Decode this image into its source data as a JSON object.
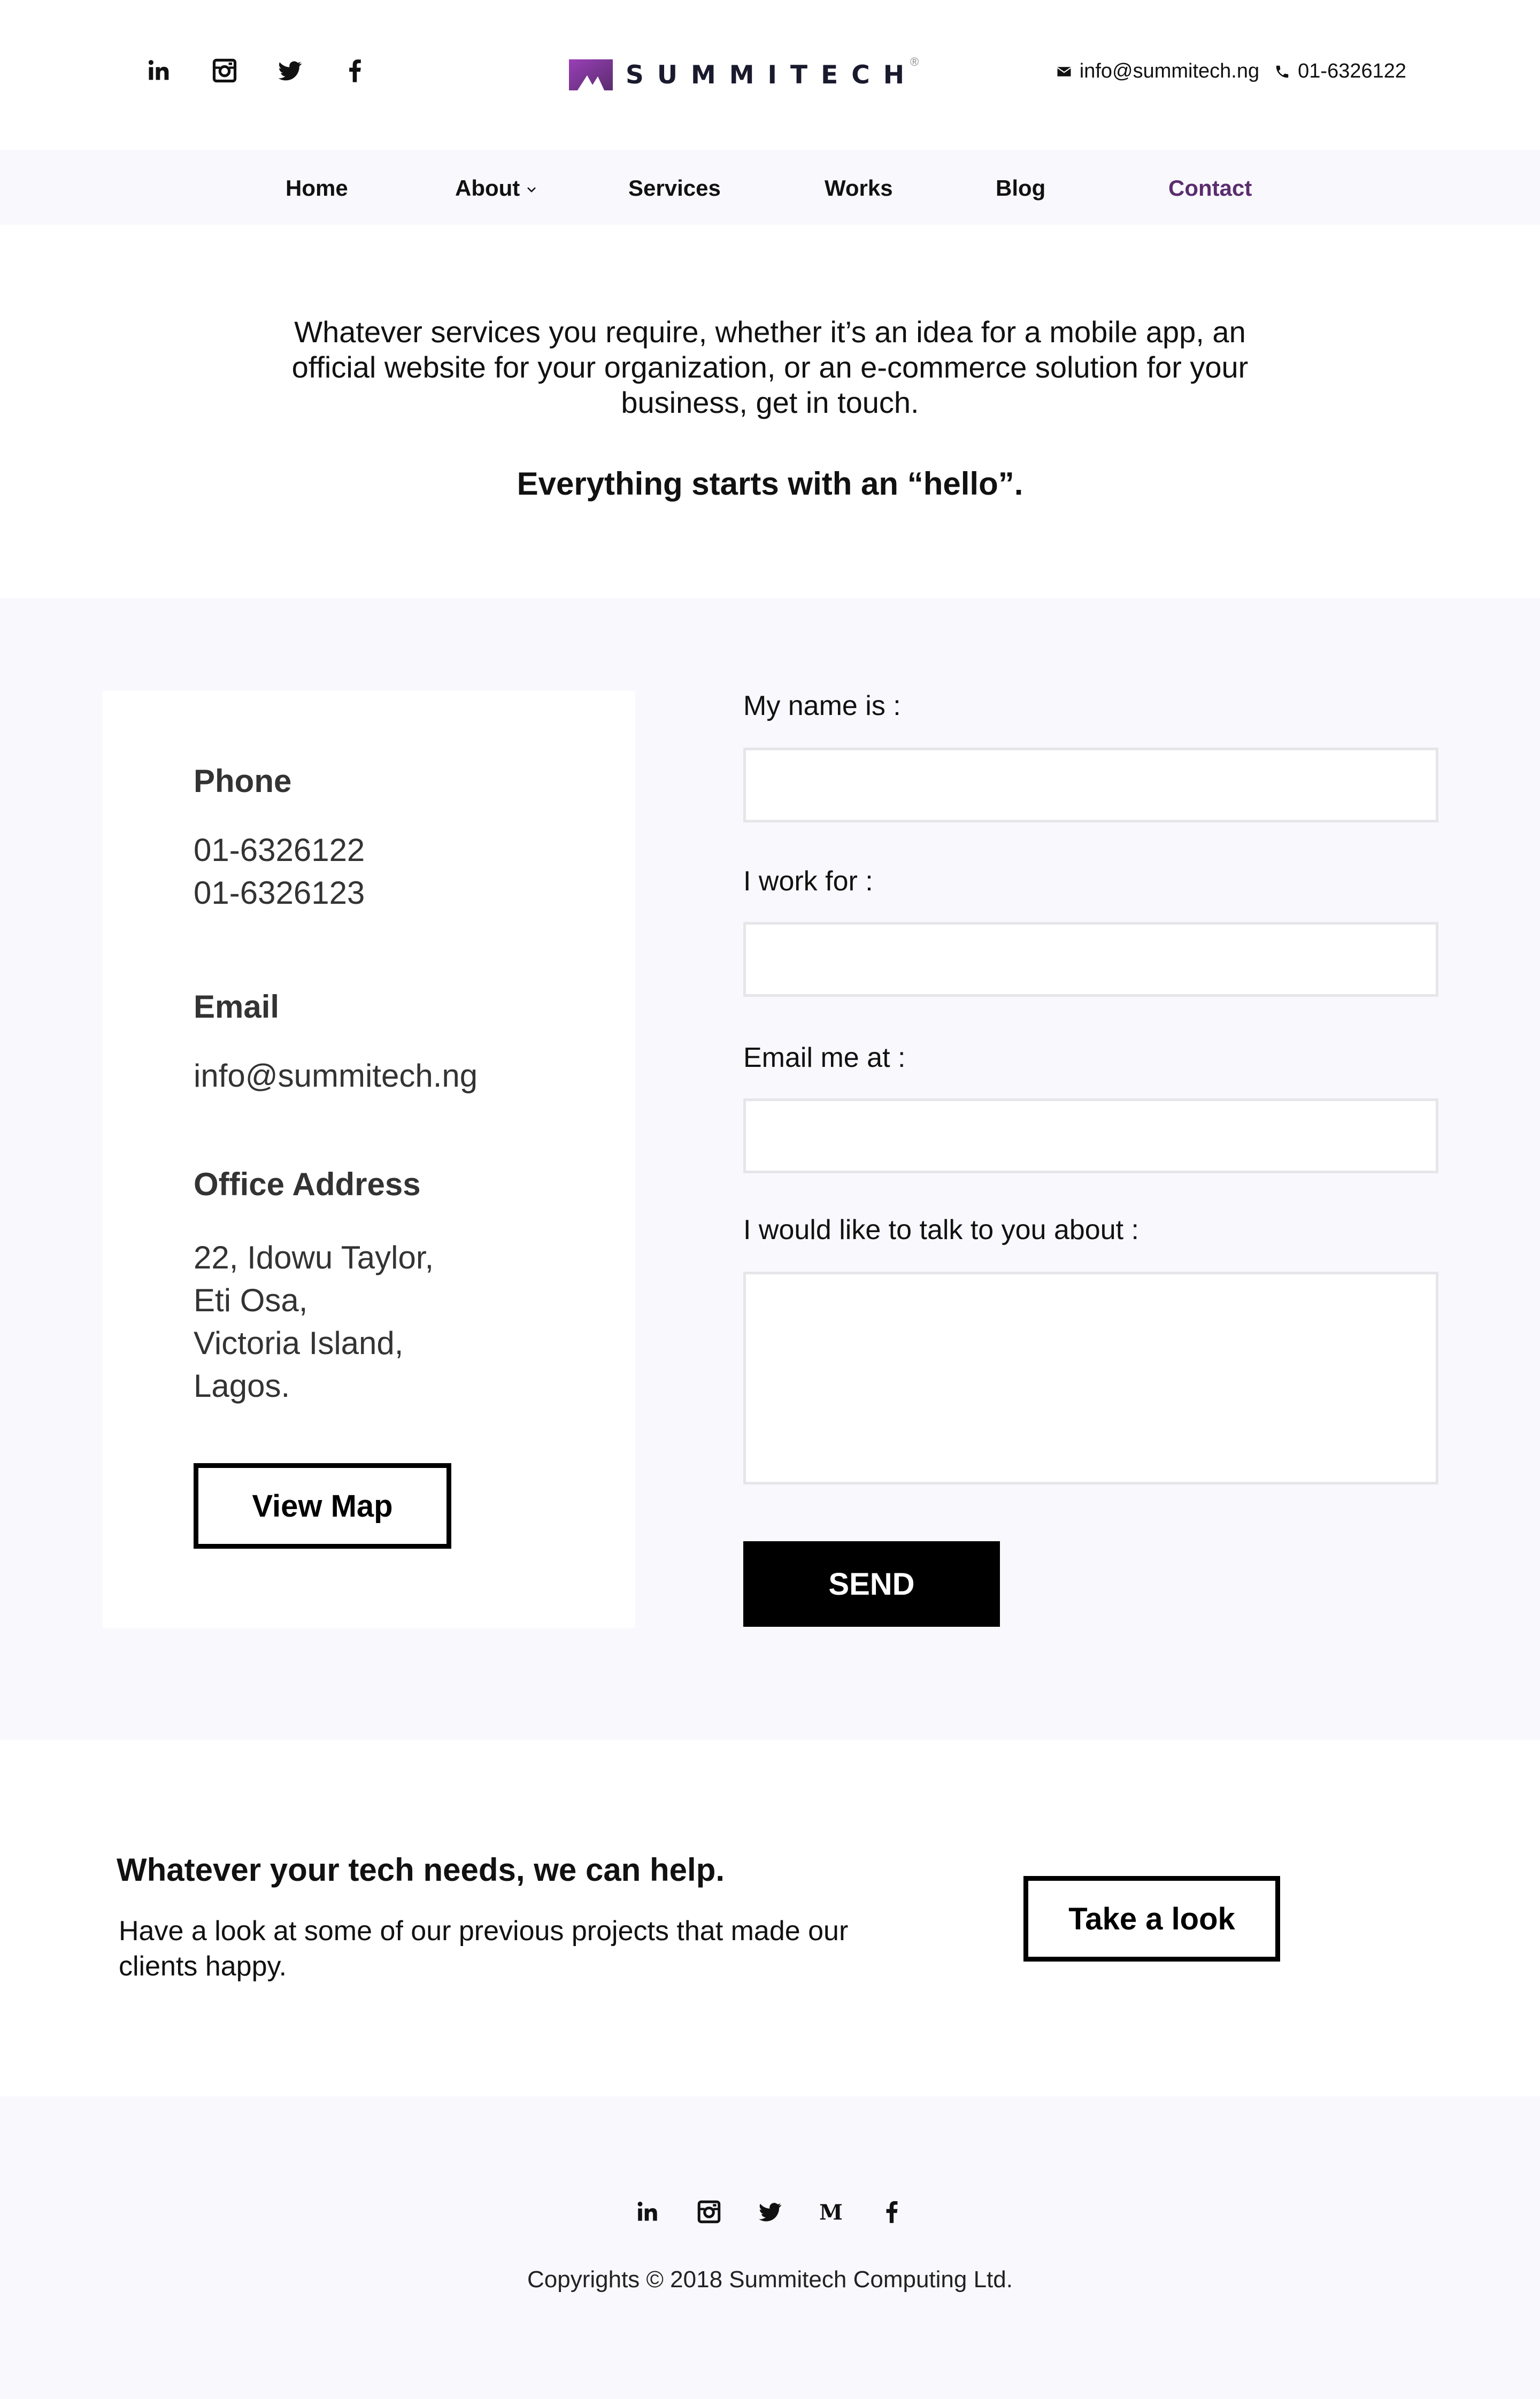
{
  "brand": {
    "name": "SUMMITECH",
    "accent": "#5a2d6e"
  },
  "header": {
    "social": [
      "linkedin-icon",
      "instagram-icon",
      "twitter-icon",
      "facebook-icon"
    ],
    "email": "info@summitech.ng",
    "phone": "01-6326122"
  },
  "nav": {
    "items": [
      {
        "label": "Home"
      },
      {
        "label": "About"
      },
      {
        "label": "Services"
      },
      {
        "label": "Works"
      },
      {
        "label": "Blog"
      },
      {
        "label": "Contact"
      }
    ],
    "active": "Contact"
  },
  "intro": {
    "text": "Whatever services you require, whether it’s an idea for a mobile app, an official website for your organization, or an e-commerce solution for your business, get in touch.",
    "hello": "Everything starts with an “hello”."
  },
  "card": {
    "phone_heading": "Phone",
    "phone_1": "01-6326122",
    "phone_2": "01-6326123",
    "email_heading": "Email",
    "email": "info@summitech.ng",
    "address_heading": "Office Address",
    "address_lines": [
      "22, Idowu Taylor,",
      "Eti Osa,",
      "Victoria Island,",
      "Lagos."
    ],
    "map_button": "View Map"
  },
  "form": {
    "name_label": "My name is :",
    "company_label": "I work for :",
    "email_label": "Email me at :",
    "message_label": "I would like to talk to you about :",
    "name_value": "",
    "company_value": "",
    "email_value": "",
    "message_value": "",
    "send_label": "SEND"
  },
  "cta": {
    "heading": "Whatever your tech needs, we can help.",
    "text": "Have a look at some of our previous projects that made our clients happy.",
    "button": "Take a look"
  },
  "footer": {
    "social": [
      "linkedin-icon",
      "instagram-icon",
      "twitter-icon",
      "medium-icon",
      "facebook-icon"
    ],
    "copyright": "Copyrights © 2018 Summitech Computing Ltd."
  }
}
